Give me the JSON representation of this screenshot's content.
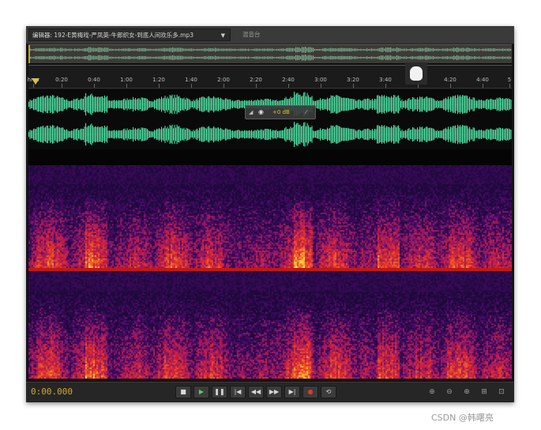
{
  "editor": {
    "tab_title": "编辑器: 192-E黄梅戏-严凤英-牛郎织女-到底人间欢乐多.mp3",
    "dropdown_glyph": "▼",
    "mixer_tab": "混音台"
  },
  "ruler": {
    "labels": [
      "hms",
      "0:20",
      "0:40",
      "1:00",
      "1:20",
      "1:40",
      "2:00",
      "2:20",
      "2:40",
      "3:00",
      "3:20",
      "3:40",
      "4:00",
      "4:20",
      "4:40",
      "5"
    ]
  },
  "hud": {
    "gain": "+0 dB"
  },
  "transport": {
    "timecode": "0:00.000",
    "buttons": [
      {
        "name": "stop-button",
        "glyph": "■",
        "color": "#d8d8d8"
      },
      {
        "name": "play-button",
        "glyph": "▶",
        "color": "#5ec85e"
      },
      {
        "name": "pause-button",
        "glyph": "❚❚",
        "color": "#d8d8d8"
      },
      {
        "name": "go-to-start-button",
        "glyph": "|◀",
        "color": "#d8d8d8"
      },
      {
        "name": "rewind-button",
        "glyph": "◀◀",
        "color": "#d8d8d8"
      },
      {
        "name": "fast-forward-button",
        "glyph": "▶▶",
        "color": "#d8d8d8"
      },
      {
        "name": "go-to-end-button",
        "glyph": "▶|",
        "color": "#d8d8d8"
      },
      {
        "name": "record-button",
        "glyph": "●",
        "color": "#d83a2a"
      },
      {
        "name": "loop-button",
        "glyph": "⟲",
        "color": "#d8d8d8"
      }
    ],
    "zoom_buttons": [
      {
        "name": "zoom-in-amplitude-button",
        "glyph": "⊕"
      },
      {
        "name": "zoom-out-amplitude-button",
        "glyph": "⊖"
      },
      {
        "name": "zoom-in-time-button",
        "glyph": "⊕"
      },
      {
        "name": "zoom-selection-button",
        "glyph": "⊞"
      },
      {
        "name": "zoom-out-full-button",
        "glyph": "⊡"
      }
    ]
  },
  "watermark": "CSDN @韩曙亮",
  "colors": {
    "waveform": "#4fdaa0",
    "timecode": "#d4a829",
    "accent": "#e8c020"
  }
}
